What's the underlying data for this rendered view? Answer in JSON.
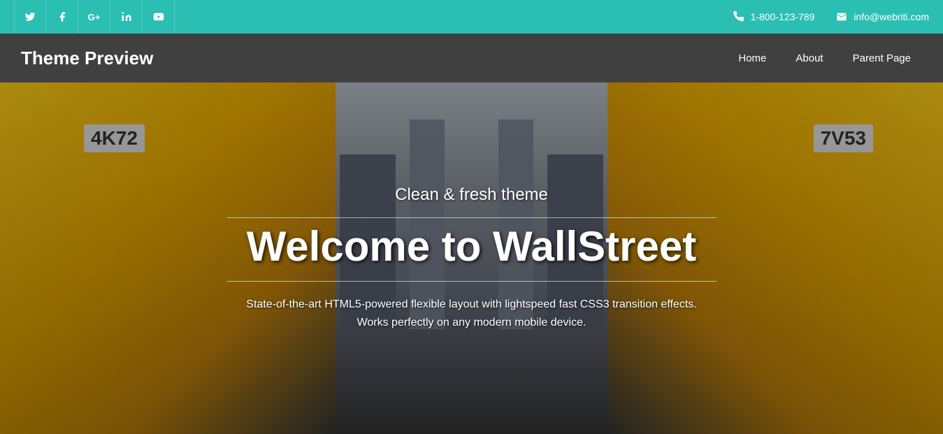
{
  "topbar": {
    "social": [
      {
        "name": "twitter",
        "icon": "𝕏",
        "unicode": "🐦",
        "symbol": "t"
      },
      {
        "name": "facebook",
        "icon": "f"
      },
      {
        "name": "google-plus",
        "icon": "G+"
      },
      {
        "name": "linkedin",
        "icon": "in"
      },
      {
        "name": "youtube",
        "icon": "▶"
      }
    ],
    "phone": "1-800-123-789",
    "email": "info@webriti.com"
  },
  "header": {
    "site_title": "Theme Preview",
    "nav": [
      {
        "label": "Home"
      },
      {
        "label": "About"
      },
      {
        "label": "Parent Page"
      }
    ]
  },
  "hero": {
    "subtitle": "Clean & fresh theme",
    "title": "Welcome to WallStreet",
    "description": "State-of-the-art HTML5-powered flexible layout with lightspeed fast CSS3 transition effects. Works perfectly on any modern mobile device."
  }
}
